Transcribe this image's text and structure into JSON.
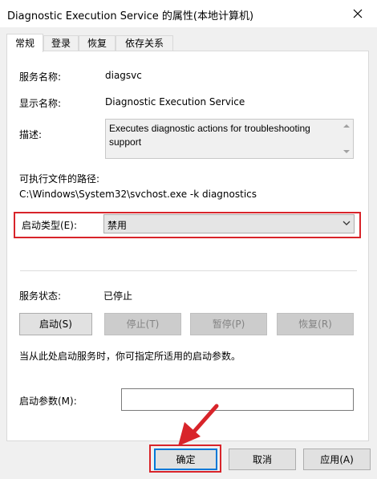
{
  "window": {
    "title": "Diagnostic Execution Service 的属性(本地计算机)",
    "close_icon": "close-icon"
  },
  "tabs": [
    {
      "label": "常规",
      "active": true
    },
    {
      "label": "登录",
      "active": false
    },
    {
      "label": "恢复",
      "active": false
    },
    {
      "label": "依存关系",
      "active": false
    }
  ],
  "general": {
    "service_name_label": "服务名称:",
    "service_name_value": "diagsvc",
    "display_name_label": "显示名称:",
    "display_name_value": "Diagnostic Execution Service",
    "description_label": "描述:",
    "description_value": "Executes diagnostic actions for troubleshooting support",
    "path_label": "可执行文件的路径:",
    "path_value": "C:\\Windows\\System32\\svchost.exe -k diagnostics",
    "startup_type_label": "启动类型(E):",
    "startup_type_value": "禁用",
    "status_label": "服务状态:",
    "status_value": "已停止",
    "start_button": "启动(S)",
    "stop_button": "停止(T)",
    "pause_button": "暂停(P)",
    "resume_button": "恢复(R)",
    "hint_text": "当从此处启动服务时，你可指定所适用的启动参数。",
    "params_label": "启动参数(M):",
    "params_value": ""
  },
  "footer": {
    "ok_button": "确定",
    "cancel_button": "取消",
    "apply_button": "应用(A)"
  },
  "colors": {
    "highlight_red": "#d8242a",
    "focus_blue": "#0078d7"
  }
}
